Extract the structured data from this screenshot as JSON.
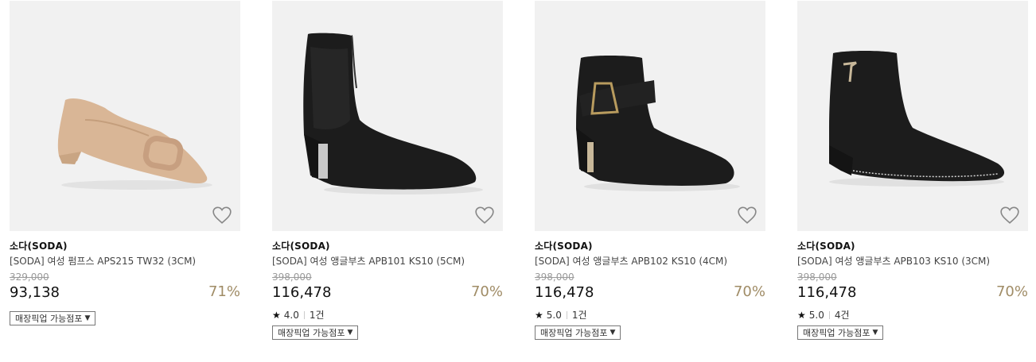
{
  "products": [
    {
      "brand": "소다(SODA)",
      "name": "[SODA] 여성 펌프스 APS215 TW32 (3CM)",
      "original_price": "329,000",
      "price": "93,138",
      "discount": "71%",
      "rating": null,
      "review_count": null,
      "pickup_label": "매장픽업 가능점포"
    },
    {
      "brand": "소다(SODA)",
      "name": "[SODA] 여성 앵글부츠 APB101 KS10 (5CM)",
      "original_price": "398,000",
      "price": "116,478",
      "discount": "70%",
      "rating": "4.0",
      "review_count": "1건",
      "pickup_label": "매장픽업 가능점포"
    },
    {
      "brand": "소다(SODA)",
      "name": "[SODA] 여성 앵글부츠 APB102 KS10 (4CM)",
      "original_price": "398,000",
      "price": "116,478",
      "discount": "70%",
      "rating": "5.0",
      "review_count": "1건",
      "pickup_label": "매장픽업 가능점포"
    },
    {
      "brand": "소다(SODA)",
      "name": "[SODA] 여성 앵글부츠 APB103 KS10 (3CM)",
      "original_price": "398,000",
      "price": "116,478",
      "discount": "70%",
      "rating": "5.0",
      "review_count": "4건",
      "pickup_label": "매장픽업 가능점포"
    }
  ],
  "icons": {
    "wishlist": "heart-outline-icon",
    "rating": "star-icon",
    "dropdown": "caret-down-icon"
  },
  "colors": {
    "discount": "#a08c66",
    "image_bg": "#f1f1f1",
    "shoe_beige": "#d9b696",
    "shoe_black": "#1c1c1c"
  }
}
